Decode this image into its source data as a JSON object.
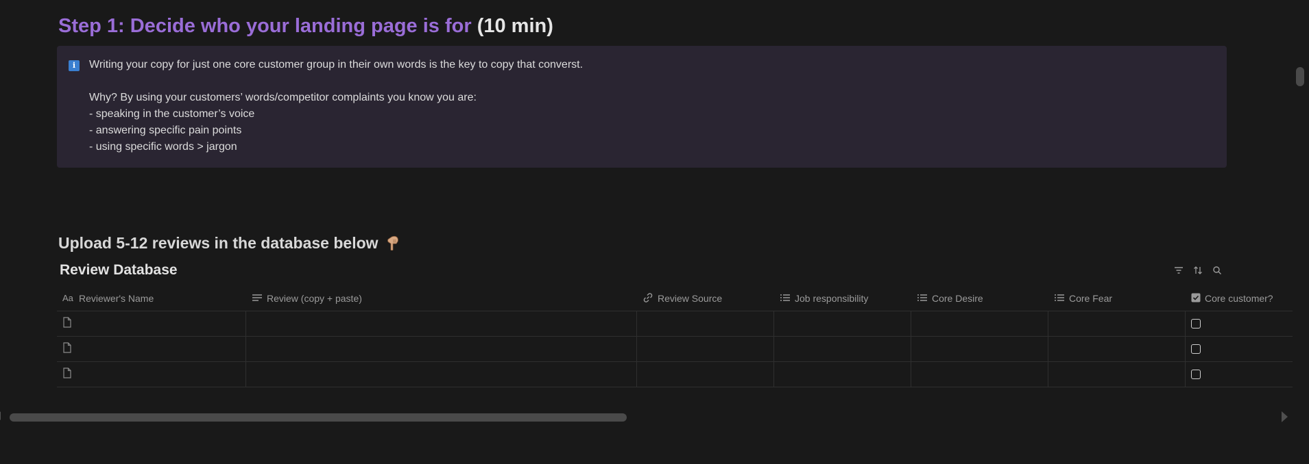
{
  "step": {
    "title_main": "Step 1: Decide who your landing page is for",
    "title_time": " (10 min)"
  },
  "callout": {
    "icon": "info-icon",
    "lines": [
      "Writing your copy for just one core customer group in their own words is the key to copy that converst.",
      "",
      "Why? By using your customers’ words/competitor complaints you know you are:",
      "- speaking in the customer’s voice",
      "- answering specific pain points",
      "- using specific words > jargon"
    ]
  },
  "upload": {
    "heading": "Upload 5-12 reviews in the database below"
  },
  "database": {
    "title": "Review Database",
    "tools": [
      "filter-icon",
      "sort-icon",
      "search-icon"
    ],
    "columns": [
      {
        "label": "Reviewer's Name",
        "icon": "title-aa-icon"
      },
      {
        "label": "Review (copy + paste)",
        "icon": "text-lines-icon"
      },
      {
        "label": "Review Source",
        "icon": "link-icon"
      },
      {
        "label": "Job responsibility",
        "icon": "list-icon"
      },
      {
        "label": "Core Desire",
        "icon": "list-icon"
      },
      {
        "label": "Core Fear",
        "icon": "list-icon"
      },
      {
        "label": "Core customer?",
        "icon": "checkbox-icon"
      }
    ],
    "rows": [
      {
        "name": "",
        "review": "",
        "source": "",
        "job": "",
        "desire": "",
        "fear": "",
        "core_customer": false
      },
      {
        "name": "",
        "review": "",
        "source": "",
        "job": "",
        "desire": "",
        "fear": "",
        "core_customer": false
      },
      {
        "name": "",
        "review": "",
        "source": "",
        "job": "",
        "desire": "",
        "fear": "",
        "core_customer": false
      }
    ]
  },
  "colors": {
    "background": "#191919",
    "heading_accent": "#9a6dd7",
    "callout_bg": "#2a2532",
    "info_icon": "#3a7fd0"
  }
}
